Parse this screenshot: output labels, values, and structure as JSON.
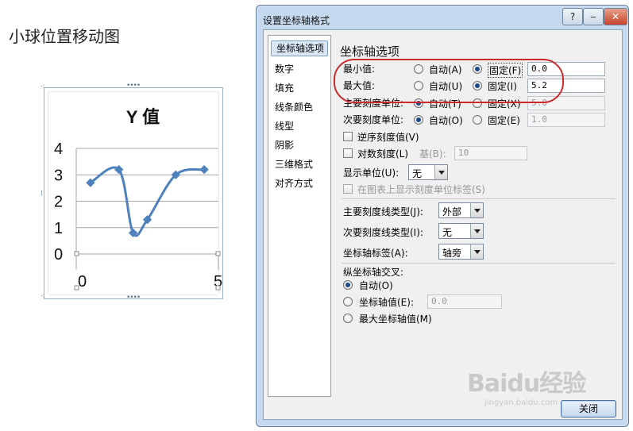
{
  "slide": {
    "title": "小球位置移动图",
    "chart": {
      "title": "Y 值",
      "y_ticks": [
        "4",
        "3",
        "2",
        "1",
        "0"
      ],
      "x_ticks": [
        "0",
        "5"
      ]
    }
  },
  "chart_data": {
    "type": "scatter",
    "title": "Y 值",
    "x": [
      0.5,
      1.5,
      2.0,
      2.5,
      3.5,
      4.5
    ],
    "series": [
      {
        "values": [
          2.7,
          3.2,
          0.8,
          1.3,
          3.0,
          3.2
        ]
      }
    ],
    "xlim": [
      0,
      5
    ],
    "ylim": [
      0,
      4
    ],
    "smoothed": true,
    "grid": true,
    "colors": {
      "line": "#4f81bd",
      "marker": "#4f81bd"
    }
  },
  "dialog": {
    "title": "设置坐标轴格式",
    "help_label": "?",
    "minimize_label": "‒",
    "close_label": "✕",
    "nav": [
      "坐标轴选项",
      "数字",
      "填充",
      "线条颜色",
      "线型",
      "阴影",
      "三维格式",
      "对齐方式"
    ],
    "section_title": "坐标轴选项",
    "min": {
      "label": "最小值:",
      "auto": "自动(A)",
      "fixed": "固定(F)",
      "value": "0.0"
    },
    "max": {
      "label": "最大值:",
      "auto": "自动(U)",
      "fixed": "固定(I)",
      "value": "5.2"
    },
    "major_unit": {
      "label": "主要刻度单位:",
      "auto": "自动(T)",
      "fixed": "固定(X)",
      "value": "5.0"
    },
    "minor_unit": {
      "label": "次要刻度单位:",
      "auto": "自动(O)",
      "fixed": "固定(E)",
      "value": "1.0"
    },
    "reverse": "逆序刻度值(V)",
    "log_scale": "对数刻度(L)",
    "base_label": "基(B):",
    "base_value": "10",
    "display_units_label": "显示单位(U):",
    "display_units_value": "无",
    "show_units_label": "在图表上显示刻度单位标签(S)",
    "major_tick_label": "主要刻度线类型(J):",
    "major_tick_value": "外部",
    "minor_tick_label": "次要刻度线类型(I):",
    "minor_tick_value": "无",
    "axis_labels_label": "坐标轴标签(A):",
    "axis_labels_value": "轴旁",
    "cross_title": "纵坐标轴交叉:",
    "cross_auto": "自动(O)",
    "cross_value_label": "坐标轴值(E):",
    "cross_value": "0.0",
    "cross_max": "最大坐标轴值(M)",
    "close_button": "关闭"
  },
  "watermark": {
    "brand": "Baidu经验",
    "url": "jingyan.baidu.com"
  },
  "colors": {
    "highlight_oval": "#cc2a2a",
    "dialog_frame": "#c5d9ee"
  }
}
